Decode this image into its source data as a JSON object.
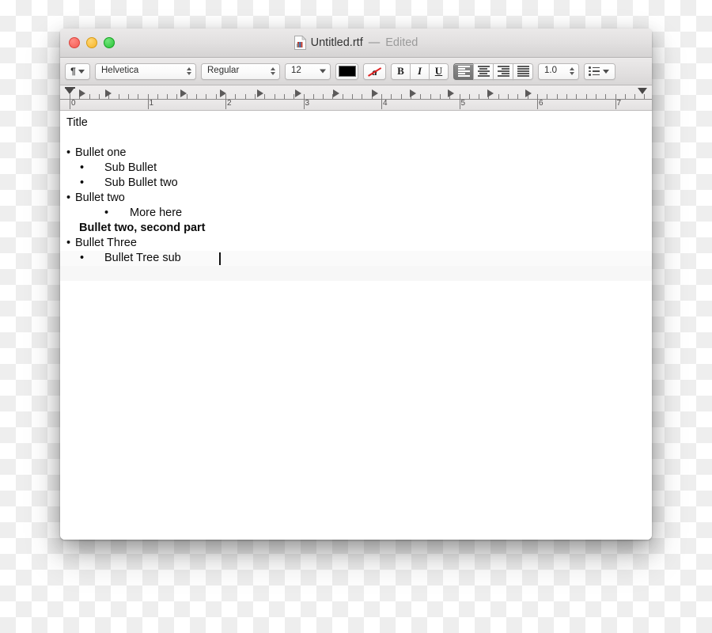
{
  "window": {
    "traffic_lights": [
      {
        "name": "close",
        "color": "#f45a52"
      },
      {
        "name": "minimize",
        "color": "#f7b52a"
      },
      {
        "name": "zoom",
        "color": "#28c236"
      }
    ],
    "title": {
      "icon": "rtf-document-icon",
      "filename": "Untitled.rtf",
      "separator": "—",
      "state": "Edited"
    }
  },
  "toolbar": {
    "paragraph_style": {
      "glyph": "¶",
      "name": "paragraph-style-menu"
    },
    "font_family": {
      "value": "Helvetica",
      "control": "stepper-combo"
    },
    "font_style": {
      "value": "Regular",
      "control": "stepper-combo"
    },
    "font_size": {
      "value": "12",
      "control": "dropdown"
    },
    "text_color": {
      "name": "text-color-well",
      "value": "#000000"
    },
    "background_color": {
      "name": "no-background-color",
      "glyph": "a",
      "slash_color": "#e02020"
    },
    "bold": {
      "label": "B",
      "active": false
    },
    "italic": {
      "label": "I",
      "active": false
    },
    "underline": {
      "label": "U",
      "active": false
    },
    "alignment": {
      "options": [
        "align-left",
        "align-center",
        "align-right",
        "align-justify"
      ],
      "selected": "align-left"
    },
    "line_spacing": {
      "value": "1.0",
      "control": "stepper-combo"
    },
    "lists": {
      "name": "list-menu",
      "control": "dropdown"
    }
  },
  "ruler": {
    "unit": "inches",
    "numbers": [
      "0",
      "1",
      "2",
      "3",
      "4",
      "5",
      "6",
      "7"
    ],
    "left_indent_marker": true,
    "right_indent_marker": true,
    "tab_stops": 14
  },
  "document": {
    "title_line": "Title",
    "bullet_glyph": "•",
    "lines": [
      {
        "type": "plain",
        "level": 0,
        "text": "Title",
        "bold": false
      },
      {
        "type": "blank",
        "level": 0,
        "text": "",
        "bold": false
      },
      {
        "type": "bullet",
        "level": 1,
        "text": "Bullet one",
        "bold": false
      },
      {
        "type": "bullet",
        "level": 2,
        "text": "Sub Bullet",
        "bold": false
      },
      {
        "type": "bullet",
        "level": 2,
        "text": "Sub Bullet two",
        "bold": false
      },
      {
        "type": "bullet",
        "level": 1,
        "text": "Bullet two",
        "bold": false
      },
      {
        "type": "bullet",
        "level": 3,
        "text": "More here",
        "bold": false
      },
      {
        "type": "plain",
        "level": 2,
        "text": "Bullet two, second part",
        "bold": true
      },
      {
        "type": "bullet",
        "level": 1,
        "text": "Bullet Three",
        "bold": false
      },
      {
        "type": "bullet",
        "level": 2,
        "text": "Bullet Tree sub",
        "bold": false
      }
    ],
    "caret_visible": true
  }
}
